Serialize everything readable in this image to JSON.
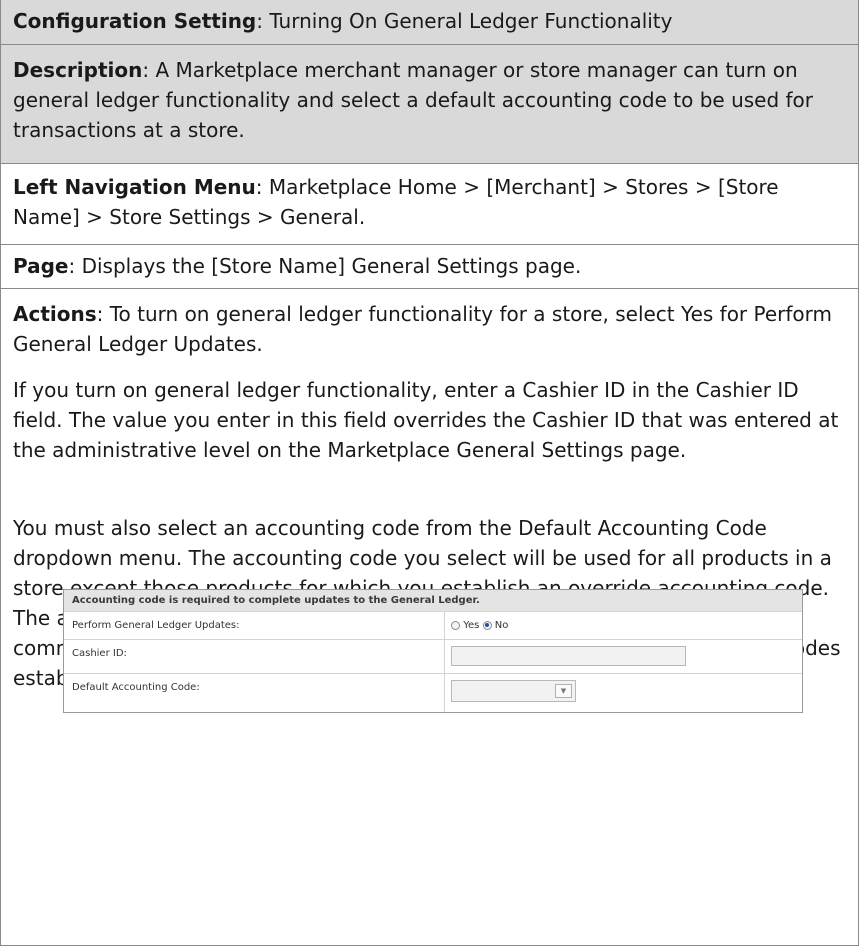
{
  "rows": {
    "config": {
      "label": "Configuration Setting",
      "text": ": Turning On General Ledger Functionality"
    },
    "description": {
      "label": "Description",
      "text": ": A Marketplace merchant manager or store manager can turn on general ledger functionality and select a default accounting code to be used for transactions at a store."
    },
    "nav": {
      "label": "Left Navigation Menu",
      "text": ": Marketplace Home > [Merchant] > Stores > [Store Name] > Store Settings > General."
    },
    "page": {
      "label": "Page",
      "text": ": Displays the [Store Name] General Settings page."
    },
    "actions": {
      "label": "Actions",
      "text": ": To turn on general ledger functionality for a store, select Yes for Perform General Ledger Updates.",
      "para2": "If you turn on general ledger functionality, enter a Cashier ID in the Cashier ID field. The value you enter in this field overrides the Cashier ID that was entered at the administrative level on the Marketplace General Settings page.",
      "para3": "You must also select an accounting code from the Default Accounting Code dropdown menu. The accounting code you select will be used for all products in a store except those products for which you establish an override accounting code. The accounting codes displayed in the dropdown menu represent both the common accounting codes that have been enabled and the new accounting codes established by a merchant manager."
    }
  },
  "screenshot": {
    "header": "Accounting code is required to complete updates to the General Ledger.",
    "perform_label": "Perform General Ledger Updates:",
    "yes_label": "Yes",
    "no_label": "No",
    "selected": "No",
    "cashier_label": "Cashier ID:",
    "cashier_value": "",
    "default_code_label": "Default Accounting Code:",
    "default_code_value": "",
    "select_icon": "dropdown-arrow-icon"
  }
}
